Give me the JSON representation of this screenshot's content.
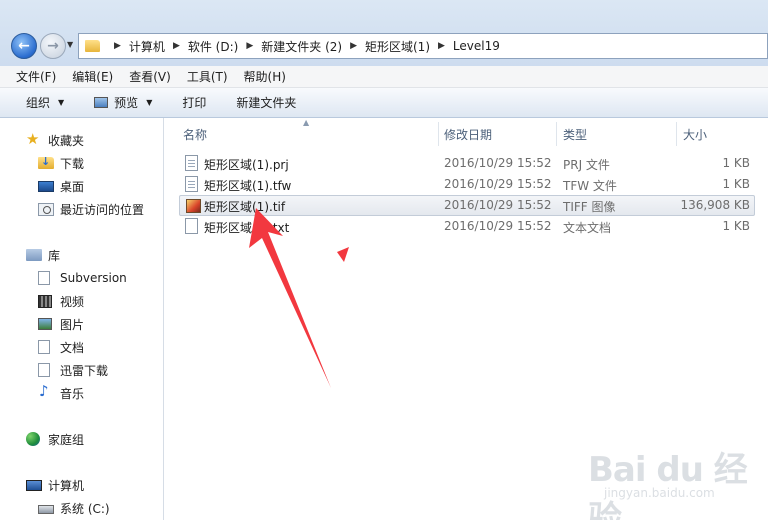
{
  "address": {
    "crumbs": [
      "计算机",
      "软件 (D:)",
      "新建文件夹 (2)",
      "矩形区域(1)",
      "Level19"
    ]
  },
  "menu": [
    "文件(F)",
    "编辑(E)",
    "查看(V)",
    "工具(T)",
    "帮助(H)"
  ],
  "toolbar": {
    "organize": "组织",
    "preview": "预览",
    "print": "打印",
    "new_folder": "新建文件夹"
  },
  "nav": {
    "favorites": "收藏夹",
    "downloads": "下载",
    "desktop": "桌面",
    "recent": "最近访问的位置",
    "libraries": "库",
    "subversion": "Subversion",
    "videos": "视频",
    "pictures": "图片",
    "documents": "文档",
    "thunder": "迅雷下载",
    "music": "音乐",
    "homegroup": "家庭组",
    "computer": "计算机",
    "system_c": "系统 (C:)"
  },
  "columns": {
    "name": "名称",
    "modified": "修改日期",
    "type": "类型",
    "size": "大小"
  },
  "files": [
    {
      "name": "矩形区域(1).prj",
      "modified": "2016/10/29 15:52",
      "type": "PRJ 文件",
      "size": "1 KB",
      "icon": "document-icon"
    },
    {
      "name": "矩形区域(1).tfw",
      "modified": "2016/10/29 15:52",
      "type": "TFW 文件",
      "size": "1 KB",
      "icon": "document-icon"
    },
    {
      "name": "矩形区域(1).tif",
      "modified": "2016/10/29 15:52",
      "type": "TIFF 图像",
      "size": "136,908 KB",
      "icon": "image-icon",
      "selected": true
    },
    {
      "name": "矩形区域(1).txt",
      "modified": "2016/10/29 15:52",
      "type": "文本文档",
      "size": "1 KB",
      "icon": "text-document-icon"
    }
  ],
  "watermark": {
    "brand": "Bai du 经验",
    "site": "jingyan.baidu.com"
  },
  "colors": {
    "annotation_arrow": "#f2383f",
    "selection": "#e4e8ee"
  }
}
